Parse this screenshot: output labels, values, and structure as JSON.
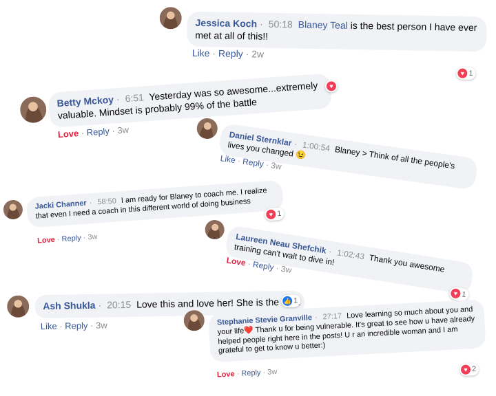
{
  "comments": [
    {
      "name": "Jessica Koch",
      "time": "50:18",
      "tag": "Blaney Teal",
      "text": " is the best person I have ever met at all of this!!",
      "actions": [
        "Like",
        "Reply",
        "2w"
      ],
      "reaction_count": "1"
    },
    {
      "name": "Betty Mckoy",
      "time": "6:51",
      "text": "Yesterday was so awesome...extremely valuable. Mindset is probably 99% of the battle",
      "actions": [
        "Love",
        "Reply",
        "3w"
      ]
    },
    {
      "name": "Daniel Sternklar",
      "time": "1:00:54",
      "text": "Blaney > Think of all the people's lives you changed 😉",
      "actions": [
        "Like",
        "Reply",
        "3w"
      ]
    },
    {
      "name": "Jacki Channer",
      "time": "58:50",
      "text": "I am ready for Blaney to coach me. I realize that even I need a coach in this different world of doing business",
      "actions": [
        "Love",
        "Reply",
        "3w"
      ],
      "reaction_count": "1"
    },
    {
      "name": "Laureen Neau Shefchik",
      "time": "1:02:43",
      "text": "Thank you awesome training can't wait to dive in!",
      "actions": [
        "Love",
        "Reply",
        "3w"
      ],
      "reaction_count": "1"
    },
    {
      "name": "Ash Shukla",
      "time": "20:15",
      "text": "Love this and love her! She is the best",
      "actions": [
        "Like",
        "Reply",
        "3w"
      ],
      "reaction_count": "1"
    },
    {
      "name": "Stephanie Stevie Granville",
      "time": "27:17",
      "text": "Love learning so much about you and your life❤️ Thank u for being vulnerable. It's great to see how u have already helped people right here in the posts! U r an incredible woman and I am grateful to get to know u better:)",
      "actions": [
        "Love",
        "Reply",
        "3w"
      ],
      "reaction_count": "2"
    }
  ],
  "colors": {
    "link": "#385898",
    "love": "#e41e3f",
    "bubble": "#f0f2f5",
    "heart": "#f33e58",
    "like": "#1877f2"
  }
}
